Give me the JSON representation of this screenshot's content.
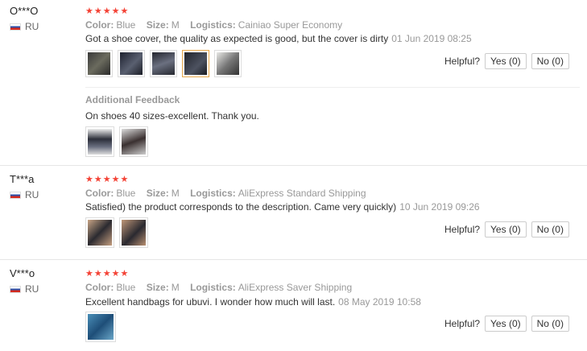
{
  "reviews": [
    {
      "user": "O***O",
      "country": "RU",
      "stars": "★★★★★",
      "color_label": "Color:",
      "color": "Blue",
      "size_label": "Size:",
      "size": "M",
      "logistics_label": "Logistics:",
      "logistics": "Cainiao Super Economy",
      "text": "Got a shoe cover, the quality as expected is good, but the cover is dirty",
      "date": "01 Jun 2019 08:25",
      "helpful_label": "Helpful?",
      "yes_label": "Yes (0)",
      "no_label": "No (0)",
      "additional_title": "Additional Feedback",
      "additional_text": "On shoes 40 sizes-excellent. Thank you."
    },
    {
      "user": "T***a",
      "country": "RU",
      "stars": "★★★★★",
      "color_label": "Color:",
      "color": "Blue",
      "size_label": "Size:",
      "size": "M",
      "logistics_label": "Logistics:",
      "logistics": "AliExpress Standard Shipping",
      "text": "Satisfied) the product corresponds to the description. Came very quickly)",
      "date": "10 Jun 2019 09:26",
      "helpful_label": "Helpful?",
      "yes_label": "Yes (0)",
      "no_label": "No (0)"
    },
    {
      "user": "V***o",
      "country": "RU",
      "stars": "★★★★★",
      "color_label": "Color:",
      "color": "Blue",
      "size_label": "Size:",
      "size": "M",
      "logistics_label": "Logistics:",
      "logistics": "AliExpress Saver Shipping",
      "text": "Excellent handbags for ubuvi. I wonder how much will last.",
      "date": "08 May 2019 10:58",
      "helpful_label": "Helpful?",
      "yes_label": "Yes (0)",
      "no_label": "No (0)"
    }
  ],
  "colors": {
    "star": "#f44336",
    "active_thumb_border": "#e8a84a",
    "meta_text": "#999999"
  }
}
